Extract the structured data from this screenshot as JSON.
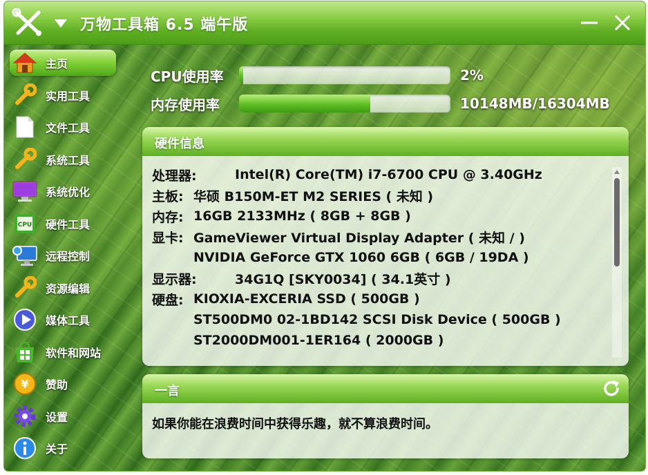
{
  "app": {
    "title": "万物工具箱 6.5 端午版"
  },
  "sidebar": {
    "items": [
      {
        "label": "主页",
        "icon": "home-icon",
        "active": true
      },
      {
        "label": "实用工具",
        "icon": "wrench-icon"
      },
      {
        "label": "文件工具",
        "icon": "file-icon"
      },
      {
        "label": "系统工具",
        "icon": "wrench-icon"
      },
      {
        "label": "系统优化",
        "icon": "monitor-icon"
      },
      {
        "label": "硬件工具",
        "icon": "cpu-icon"
      },
      {
        "label": "远程控制",
        "icon": "remote-desktop-icon"
      },
      {
        "label": "资源编辑",
        "icon": "wrench-icon"
      },
      {
        "label": "媒体工具",
        "icon": "play-icon"
      },
      {
        "label": "软件和网站",
        "icon": "windows-store-icon"
      },
      {
        "label": "赞助",
        "icon": "yen-coin-icon"
      },
      {
        "label": "设置",
        "icon": "gear-icon"
      },
      {
        "label": "关于",
        "icon": "info-icon"
      }
    ]
  },
  "usage": {
    "cpu": {
      "label": "CPU使用率",
      "value": "2%",
      "fraction": 0.02
    },
    "memory": {
      "label": "内存使用率",
      "value": "10148MB/16304MB",
      "fraction": 0.622
    }
  },
  "hardware": {
    "title": "硬件信息",
    "rows": [
      {
        "key": "处理器:",
        "value": "Intel(R) Core(TM) i7-6700 CPU @ 3.40GHz"
      },
      {
        "key": "主板:",
        "value": "华硕 B150M-ET M2 SERIES ( 未知 )"
      },
      {
        "key": "内存:",
        "value": "16GB 2133MHz ( 8GB + 8GB )"
      },
      {
        "key": "显卡:",
        "value": "GameViewer Virtual Display Adapter ( 未知 / )"
      },
      {
        "key": "",
        "value": "NVIDIA GeForce GTX 1060 6GB ( 6GB / 19DA )"
      },
      {
        "key": "显示器:",
        "value": "34G1Q [SKY0034] ( 34.1英寸 )"
      },
      {
        "key": "硬盘:",
        "value": "KIOXIA-EXCERIA SSD ( 500GB )"
      },
      {
        "key": "",
        "value": "ST500DM0 02-1BD142 SCSI Disk Device ( 500GB )"
      },
      {
        "key": "",
        "value": "ST2000DM001-1ER164 ( 2000GB )"
      }
    ]
  },
  "quote": {
    "title": "一言",
    "text": "如果你能在浪费时间中获得乐趣，就不算浪费时间。"
  }
}
